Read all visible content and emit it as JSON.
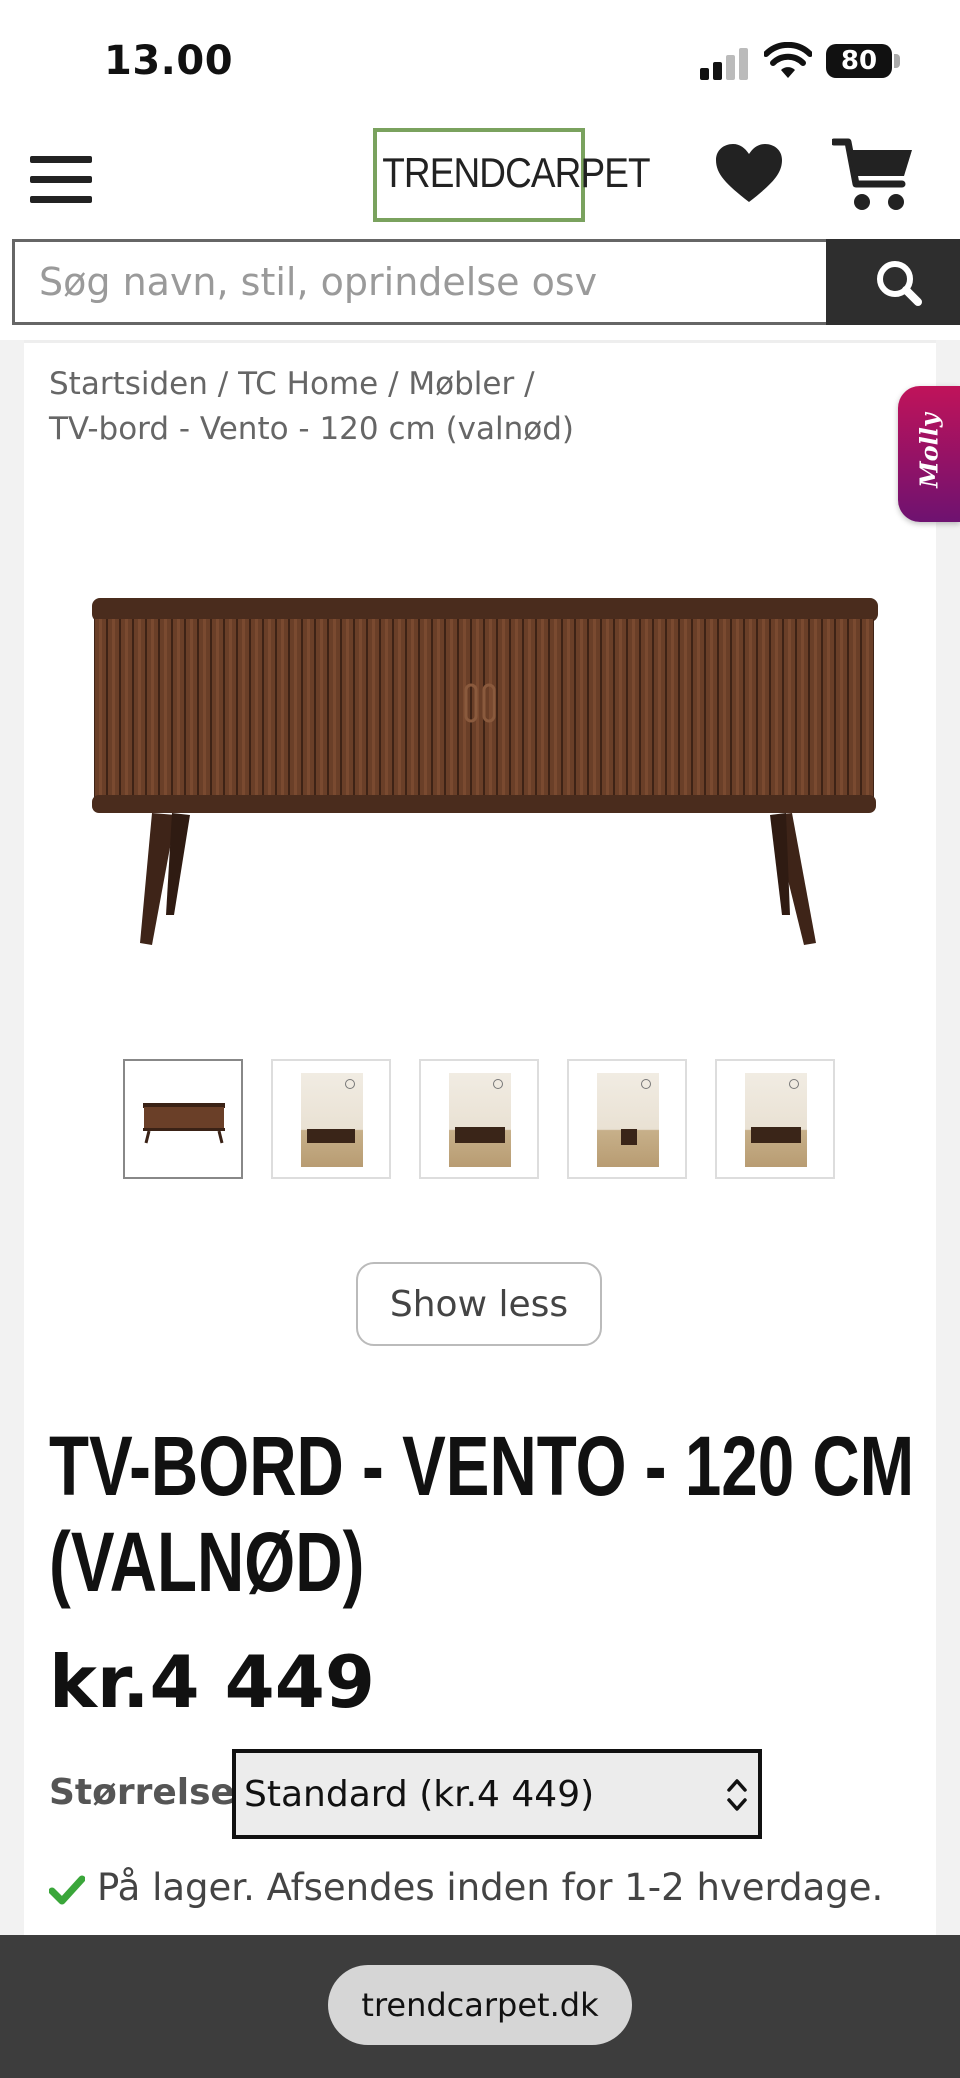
{
  "status_bar": {
    "time": "13.00",
    "battery": "80"
  },
  "header": {
    "logo_text": "TRENDCARPET"
  },
  "search": {
    "placeholder": "Søg navn, stil, oprindelse osv"
  },
  "breadcrumb": {
    "items": [
      "Startsiden",
      "TC Home",
      "Møbler"
    ],
    "current": "TV-bord - Vento - 120 cm (valnød)",
    "separator": "/"
  },
  "molly": {
    "label": "Molly"
  },
  "gallery": {
    "thumbnail_count": 5,
    "active_index": 0,
    "show_less_label": "Show less"
  },
  "product": {
    "title_line1": "TV-BORD - VENTO - 120 CM",
    "title_line2": "(VALNØD)",
    "price": "kr.4 449",
    "size_label": "Størrelse:",
    "size_selected": "Standard (kr.4 449)",
    "stock_text": "På lager. Afsendes inden for 1-2 hverdage."
  },
  "browser": {
    "url": "trendcarpet.dk"
  },
  "colors": {
    "logo_green": "#7aa25e",
    "stock_green": "#3aa63a",
    "molly_pink": "#c0135a",
    "search_button": "#2e2e2e"
  }
}
